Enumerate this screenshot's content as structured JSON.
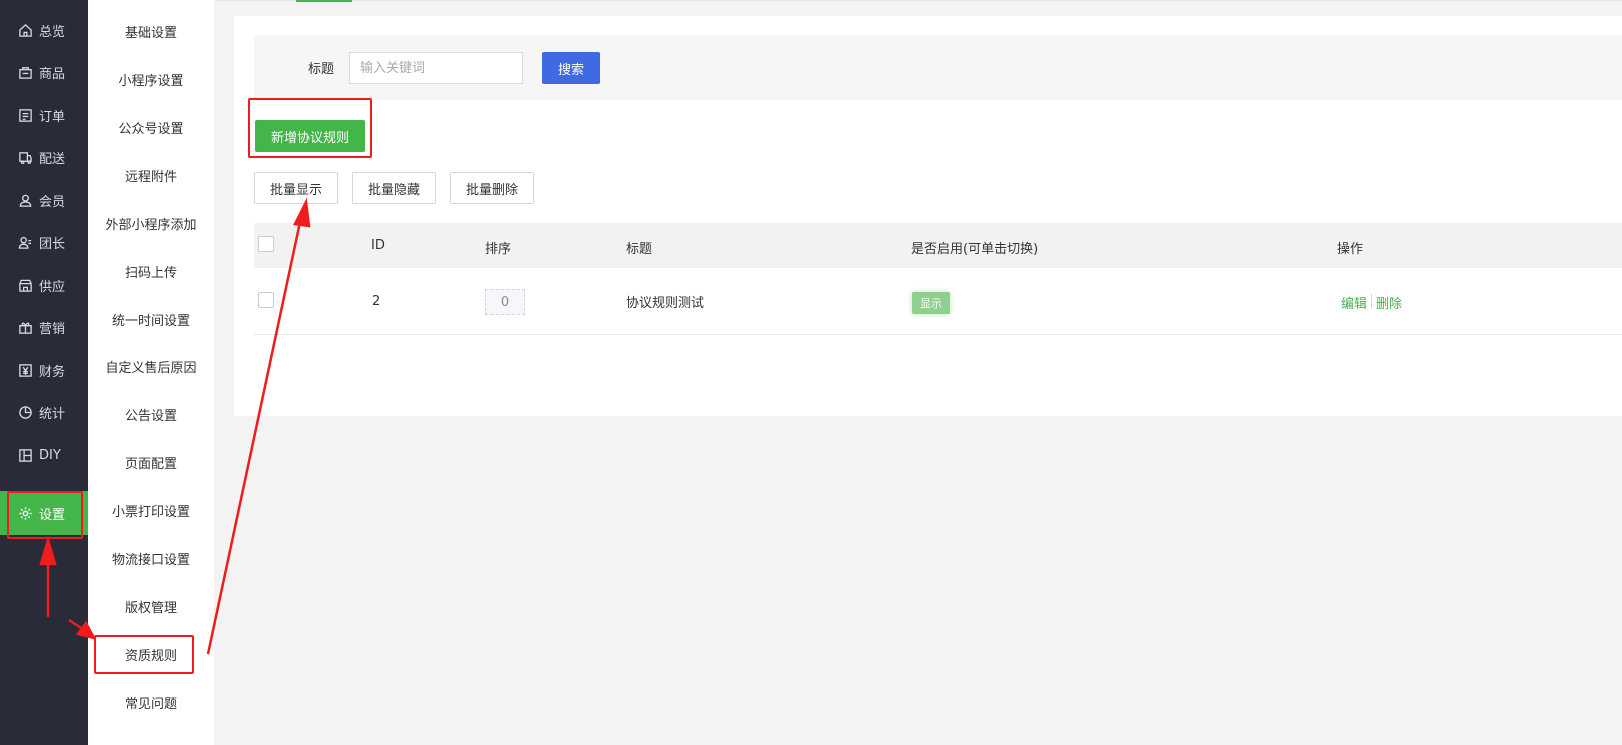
{
  "nav_primary": [
    {
      "label": "总览",
      "icon": "home-icon"
    },
    {
      "label": "商品",
      "icon": "bag-icon"
    },
    {
      "label": "订单",
      "icon": "order-icon"
    },
    {
      "label": "配送",
      "icon": "delivery-icon"
    },
    {
      "label": "会员",
      "icon": "user-icon"
    },
    {
      "label": "团长",
      "icon": "leader-icon"
    },
    {
      "label": "供应",
      "icon": "store-icon"
    },
    {
      "label": "营销",
      "icon": "gift-icon"
    },
    {
      "label": "财务",
      "icon": "yen-icon"
    },
    {
      "label": "统计",
      "icon": "pie-icon"
    },
    {
      "label": "DIY",
      "icon": "layout-icon"
    },
    {
      "label": "设置",
      "icon": "gear-icon",
      "active": true
    }
  ],
  "nav_secondary": [
    "基础设置",
    "小程序设置",
    "公众号设置",
    "远程附件",
    "外部小程序添加",
    "扫码上传",
    "统一时间设置",
    "自定义售后原因",
    "公告设置",
    "页面配置",
    "小票打印设置",
    "物流接口设置",
    "版权管理",
    "资质规则",
    "常见问题"
  ],
  "search": {
    "label": "标题",
    "placeholder": "输入关键词",
    "button": "搜索"
  },
  "toolbar": {
    "add_label": "新增协议规则",
    "batch_show": "批量显示",
    "batch_hide": "批量隐藏",
    "batch_delete": "批量删除"
  },
  "table": {
    "headers": {
      "id": "ID",
      "sort": "排序",
      "title": "标题",
      "enabled": "是否启用(可单击切换)",
      "actions": "操作"
    },
    "rows": [
      {
        "id": "2",
        "sort": "0",
        "title": "协议规则测试",
        "status": "显示",
        "edit": "编辑",
        "delete": "删除"
      }
    ]
  },
  "colors": {
    "accent": "#44b549",
    "primary": "#3f6ae3",
    "sidebar": "#2a2b39",
    "annotation": "#f01c1c"
  }
}
